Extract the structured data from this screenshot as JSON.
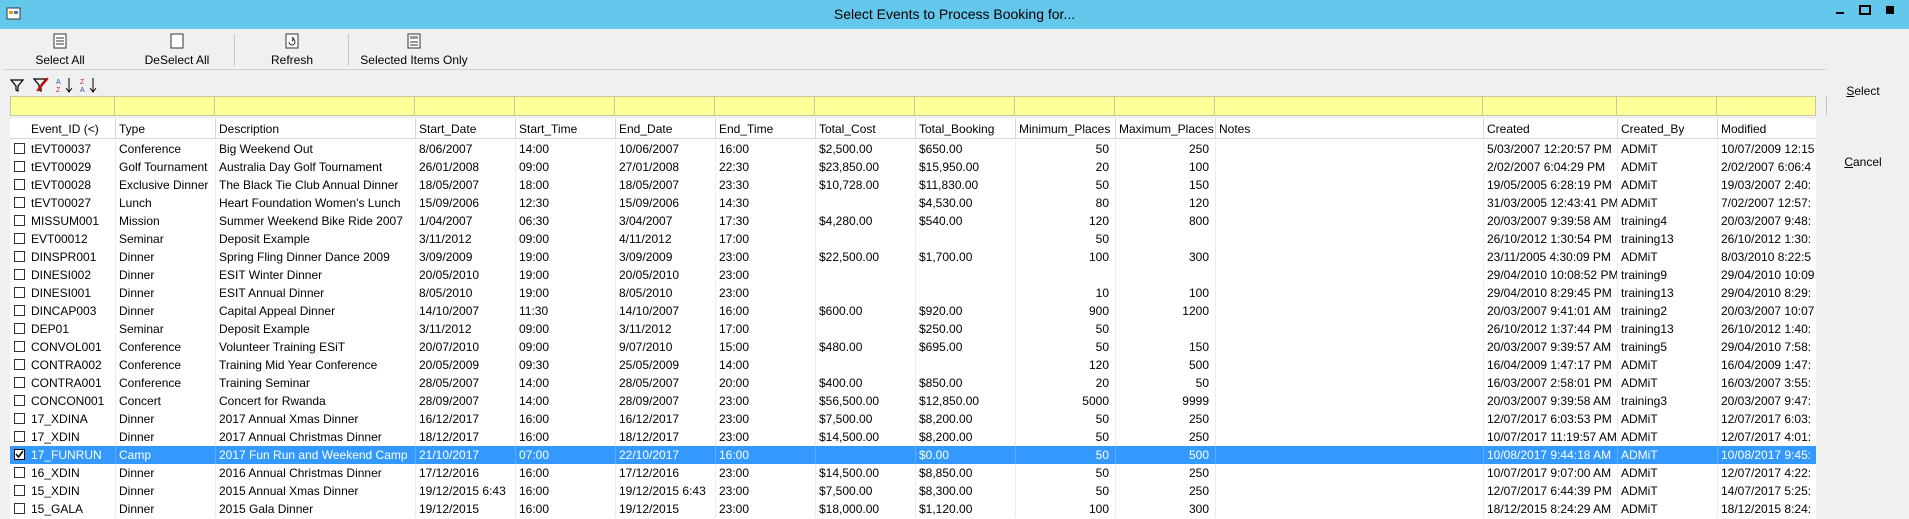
{
  "window": {
    "title": "Select Events to Process Booking for..."
  },
  "toolbar": {
    "select_all": "Select All",
    "deselect_all": "DeSelect All",
    "refresh": "Refresh",
    "selected_only": "Selected Items Only"
  },
  "side": {
    "select": "Select",
    "cancel": "Cancel"
  },
  "columns": [
    "Event_ID (<)",
    "Type",
    "Description",
    "Start_Date",
    "Start_Time",
    "End_Date",
    "End_Time",
    "Total_Cost",
    "Total_Booking",
    "Minimum_Places",
    "Maximum_Places",
    "Notes",
    "Created",
    "Created_By",
    "Modified"
  ],
  "rows": [
    {
      "checked": false,
      "selected": false,
      "cells": [
        "tEVT00037",
        "Conference",
        "Big Weekend Out",
        "8/06/2007",
        "14:00",
        "10/06/2007",
        "16:00",
        "$2,500.00",
        "$650.00",
        "50",
        "250",
        "",
        "5/03/2007 12:20:57 PM",
        "ADMiT",
        "10/07/2009 12:15"
      ]
    },
    {
      "checked": false,
      "selected": false,
      "cells": [
        "tEVT00029",
        "Golf Tournament",
        "Australia Day Golf Tournament",
        "26/01/2008",
        "09:00",
        "27/01/2008",
        "22:30",
        "$23,850.00",
        "$15,950.00",
        "20",
        "100",
        "",
        "2/02/2007 6:04:29 PM",
        "ADMiT",
        "2/02/2007 6:06:4"
      ]
    },
    {
      "checked": false,
      "selected": false,
      "cells": [
        "tEVT00028",
        "Exclusive Dinner",
        "The Black Tie Club Annual Dinner",
        "18/05/2007",
        "18:00",
        "18/05/2007",
        "23:30",
        "$10,728.00",
        "$11,830.00",
        "50",
        "150",
        "",
        "19/05/2005 6:28:19 PM",
        "ADMiT",
        "19/03/2007 2:40:"
      ]
    },
    {
      "checked": false,
      "selected": false,
      "cells": [
        "tEVT00027",
        "Lunch",
        "Heart Foundation Women's Lunch",
        "15/09/2006",
        "12:30",
        "15/09/2006",
        "14:30",
        "",
        "$4,530.00",
        "80",
        "120",
        "",
        "31/03/2005 12:43:41 PM",
        "ADMiT",
        "7/02/2007 12:57:"
      ]
    },
    {
      "checked": false,
      "selected": false,
      "cells": [
        "MISSUM001",
        "Mission",
        "Summer Weekend Bike Ride 2007",
        "1/04/2007",
        "06:30",
        "3/04/2007",
        "17:30",
        "$4,280.00",
        "$540.00",
        "120",
        "800",
        "",
        "20/03/2007 9:39:58 AM",
        "training4",
        "20/03/2007 9:48:"
      ]
    },
    {
      "checked": false,
      "selected": false,
      "cells": [
        "EVT00012",
        "Seminar",
        "Deposit Example",
        "3/11/2012",
        "09:00",
        "4/11/2012",
        "17:00",
        "",
        "",
        "50",
        "",
        "",
        "26/10/2012 1:30:54 PM",
        "training13",
        "26/10/2012 1:30:"
      ]
    },
    {
      "checked": false,
      "selected": false,
      "cells": [
        "DINSPR001",
        "Dinner",
        "Spring Fling Dinner Dance 2009",
        "3/09/2009",
        "19:00",
        "3/09/2009",
        "23:00",
        "$22,500.00",
        "$1,700.00",
        "100",
        "300",
        "",
        "23/11/2005 4:30:09 PM",
        "ADMiT",
        "8/03/2010 8:22:5"
      ]
    },
    {
      "checked": false,
      "selected": false,
      "cells": [
        "DINESI002",
        "Dinner",
        "ESIT Winter Dinner",
        "20/05/2010",
        "19:00",
        "20/05/2010",
        "23:00",
        "",
        "",
        "",
        "",
        "",
        "29/04/2010 10:08:52 PM",
        "training9",
        "29/04/2010 10:09"
      ]
    },
    {
      "checked": false,
      "selected": false,
      "cells": [
        "DINESI001",
        "Dinner",
        "ESIT Annual Dinner",
        "8/05/2010",
        "19:00",
        "8/05/2010",
        "23:00",
        "",
        "",
        "10",
        "100",
        "",
        "29/04/2010 8:29:45 PM",
        "training13",
        "29/04/2010 8:29:"
      ]
    },
    {
      "checked": false,
      "selected": false,
      "cells": [
        "DINCAP003",
        "Dinner",
        "Capital Appeal Dinner",
        "14/10/2007",
        "11:30",
        "14/10/2007",
        "16:00",
        "$600.00",
        "$920.00",
        "900",
        "1200",
        "",
        "20/03/2007 9:41:01 AM",
        "training2",
        "20/03/2007 10:07"
      ]
    },
    {
      "checked": false,
      "selected": false,
      "cells": [
        "DEP01",
        "Seminar",
        "Deposit Example",
        "3/11/2012",
        "09:00",
        "3/11/2012",
        "17:00",
        "",
        "$250.00",
        "50",
        "",
        "",
        "26/10/2012 1:37:44 PM",
        "training13",
        "26/10/2012 1:40:"
      ]
    },
    {
      "checked": false,
      "selected": false,
      "cells": [
        "CONVOL001",
        "Conference",
        "Volunteer Training ESiT",
        "20/07/2010",
        "09:00",
        "9/07/2010",
        "15:00",
        "$480.00",
        "$695.00",
        "50",
        "150",
        "",
        "20/03/2007 9:39:57 AM",
        "training5",
        "29/04/2010 7:58:"
      ]
    },
    {
      "checked": false,
      "selected": false,
      "cells": [
        "CONTRA002",
        "Conference",
        "Training Mid Year Conference",
        "20/05/2009",
        "09:30",
        "25/05/2009",
        "14:00",
        "",
        "",
        "120",
        "500",
        "",
        "16/04/2009 1:47:17 PM",
        "ADMiT",
        "16/04/2009 1:47:"
      ]
    },
    {
      "checked": false,
      "selected": false,
      "cells": [
        "CONTRA001",
        "Conference",
        "Training Seminar",
        "28/05/2007",
        "14:00",
        "28/05/2007",
        "20:00",
        "$400.00",
        "$850.00",
        "20",
        "50",
        "",
        "16/03/2007 2:58:01 PM",
        "ADMiT",
        "16/03/2007 3:55:"
      ]
    },
    {
      "checked": false,
      "selected": false,
      "cells": [
        "CONCON001",
        "Concert",
        "Concert for Rwanda",
        "28/09/2007",
        "14:00",
        "28/09/2007",
        "23:00",
        "$56,500.00",
        "$12,850.00",
        "5000",
        "9999",
        "",
        "20/03/2007 9:39:58 AM",
        "training3",
        "20/03/2007 9:47:"
      ]
    },
    {
      "checked": false,
      "selected": false,
      "cells": [
        "17_XDINA",
        "Dinner",
        "2017 Annual Xmas Dinner",
        "16/12/2017",
        "16:00",
        "16/12/2017",
        "23:00",
        "$7,500.00",
        "$8,200.00",
        "50",
        "250",
        "",
        "12/07/2017 6:03:53 PM",
        "ADMiT",
        "12/07/2017 6:03:"
      ]
    },
    {
      "checked": false,
      "selected": false,
      "cells": [
        "17_XDIN",
        "Dinner",
        "2017 Annual Christmas Dinner",
        "18/12/2017",
        "16:00",
        "18/12/2017",
        "23:00",
        "$14,500.00",
        "$8,200.00",
        "50",
        "250",
        "",
        "10/07/2017 11:19:57 AM",
        "ADMiT",
        "12/07/2017 4:01:"
      ]
    },
    {
      "checked": true,
      "selected": true,
      "cells": [
        "17_FUNRUN",
        "Camp",
        "2017 Fun Run and Weekend Camp",
        "21/10/2017",
        "07:00",
        "22/10/2017",
        "16:00",
        "",
        "$0.00",
        "50",
        "500",
        "",
        "10/08/2017 9:44:18 AM",
        "ADMiT",
        "10/08/2017 9:45:"
      ]
    },
    {
      "checked": false,
      "selected": false,
      "cells": [
        "16_XDIN",
        "Dinner",
        "2016 Annual Christmas Dinner",
        "17/12/2016",
        "16:00",
        "17/12/2016",
        "23:00",
        "$14,500.00",
        "$8,850.00",
        "50",
        "250",
        "",
        "10/07/2017 9:07:00 AM",
        "ADMiT",
        "12/07/2017 4:22:"
      ]
    },
    {
      "checked": false,
      "selected": false,
      "cells": [
        "15_XDIN",
        "Dinner",
        "2015 Annual Xmas Dinner",
        "19/12/2015 6:43",
        "16:00",
        "19/12/2015 6:43",
        "23:00",
        "$7,500.00",
        "$8,300.00",
        "50",
        "250",
        "",
        "12/07/2017 6:44:39 PM",
        "ADMiT",
        "14/07/2017 5:25:"
      ]
    },
    {
      "checked": false,
      "selected": false,
      "cells": [
        "15_GALA",
        "Dinner",
        "2015 Gala Dinner",
        "19/12/2015",
        "16:00",
        "19/12/2015",
        "23:00",
        "$18,000.00",
        "$1,120.00",
        "100",
        "300",
        "",
        "18/12/2015 8:24:29 AM",
        "ADMiT",
        "18/12/2015 8:24:"
      ]
    }
  ]
}
